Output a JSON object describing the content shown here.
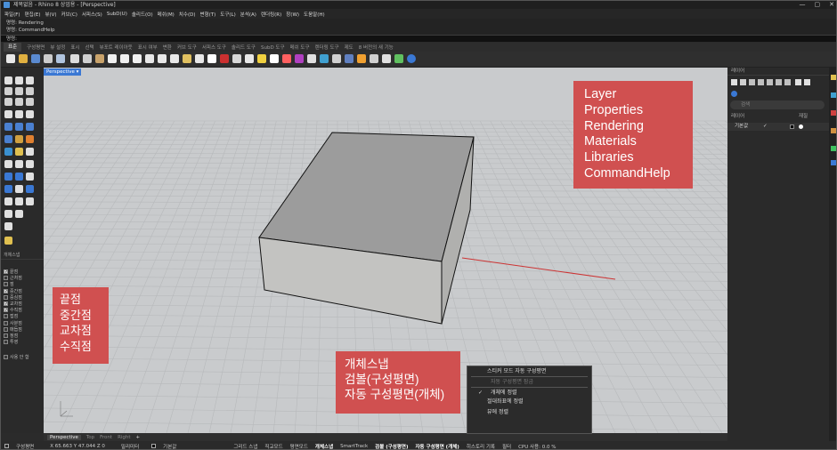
{
  "titlebar": {
    "title": "제목없음 - Rhino 8 상업용 - [Perspective]",
    "minimize": "—",
    "maximize": "▢",
    "close": "✕"
  },
  "menu": [
    "파일(F)",
    "편집(E)",
    "뷰(V)",
    "커브(C)",
    "서피스(S)",
    "SubD(U)",
    "솔리드(O)",
    "메쉬(M)",
    "치수(D)",
    "변형(T)",
    "도구(L)",
    "분석(A)",
    "렌더링(R)",
    "창(W)",
    "도움말(H)"
  ],
  "command": {
    "history": [
      "명령: Rendering",
      "명령: CommandHelp"
    ],
    "prompt": "명령:"
  },
  "tabs": [
    "표준",
    "구성평면",
    "뷰 설정",
    "표시",
    "선택",
    "뷰포트 레이아웃",
    "표시 여부",
    "변환",
    "커브 도구",
    "서피스 도구",
    "솔리드 도구",
    "SubD 도구",
    "메쉬 도구",
    "렌더링 도구",
    "제도",
    "8 버전의 새 기능"
  ],
  "active_tab": "표준",
  "viewport": {
    "label": "Perspective"
  },
  "viewport_tabs": [
    "Perspective",
    "Top",
    "Front",
    "Right"
  ],
  "add_tab": "+",
  "snap_panel": {
    "title": "개체스냅",
    "items": [
      {
        "label": "끝점",
        "checked": true
      },
      {
        "label": "근처점",
        "checked": false
      },
      {
        "label": "점",
        "checked": false
      },
      {
        "label": "중간점",
        "checked": true
      },
      {
        "label": "중심점",
        "checked": false
      },
      {
        "label": "교차점",
        "checked": true
      },
      {
        "label": "수직점",
        "checked": true
      },
      {
        "label": "접점",
        "checked": false
      },
      {
        "label": "사분점",
        "checked": false
      },
      {
        "label": "매듭점",
        "checked": false
      },
      {
        "label": "정점",
        "checked": false
      },
      {
        "label": "투영",
        "checked": false
      }
    ],
    "disable_label": "사용 안 함"
  },
  "right_panel": {
    "title": "레이어",
    "search_placeholder": "검색",
    "col_layer": "레이어",
    "col_material": "재질",
    "row_name": "기본값",
    "row_check": "✓"
  },
  "notes": {
    "panels": [
      "Layer",
      "Properties",
      "Rendering",
      "Materials",
      "Libraries",
      "CommandHelp"
    ],
    "snaps": [
      "끝점",
      "중간점",
      "교차점",
      "수직점"
    ],
    "gumball": [
      "개체스냅",
      "검볼(구성평면)",
      "자동 구성평면(개체)"
    ]
  },
  "context_menu": {
    "items": [
      {
        "label": "스티커 모드 자동 구성평면",
        "disabled": false,
        "checked": false,
        "sep_before": false
      },
      {
        "label": "자동 구성평면 잠금",
        "disabled": true,
        "checked": false,
        "sep_before": true
      },
      {
        "label": "개체에 정렬",
        "disabled": false,
        "checked": true,
        "sep_before": true
      },
      {
        "label": "절대좌표에 정렬",
        "disabled": false,
        "checked": false,
        "sep_before": false
      },
      {
        "label": "뷰에 정렬",
        "disabled": false,
        "checked": false,
        "sep_before": false
      }
    ],
    "check_mark": "✓"
  },
  "statusbar": {
    "cplane": "구성평면",
    "coords": "X 65.663 Y 47.044 Z 0",
    "units": "밀리미터",
    "layer": "기본값",
    "items": [
      {
        "label": "그리드 스냅",
        "on": false
      },
      {
        "label": "직교모드",
        "on": false
      },
      {
        "label": "평면모드",
        "on": false
      },
      {
        "label": "개체스냅",
        "on": true
      },
      {
        "label": "SmartTrack",
        "on": false
      },
      {
        "label": "검볼 (구성평면)",
        "on": true
      },
      {
        "label": "자동 구성평면 (개체)",
        "on": true
      },
      {
        "label": "히스토리 기록",
        "on": false
      },
      {
        "label": "필터",
        "on": false
      },
      {
        "label": "CPU 사용: 0.0 %",
        "on": false
      }
    ]
  },
  "colors": {
    "accent": "#3a78d4",
    "note": "#d05050",
    "viewport_bg": "#c9cbcd",
    "box_top": "#9c9c9c",
    "box_front": "#c3c3c1",
    "box_side": "#b0b0ae",
    "x_axis": "#cc3333"
  }
}
